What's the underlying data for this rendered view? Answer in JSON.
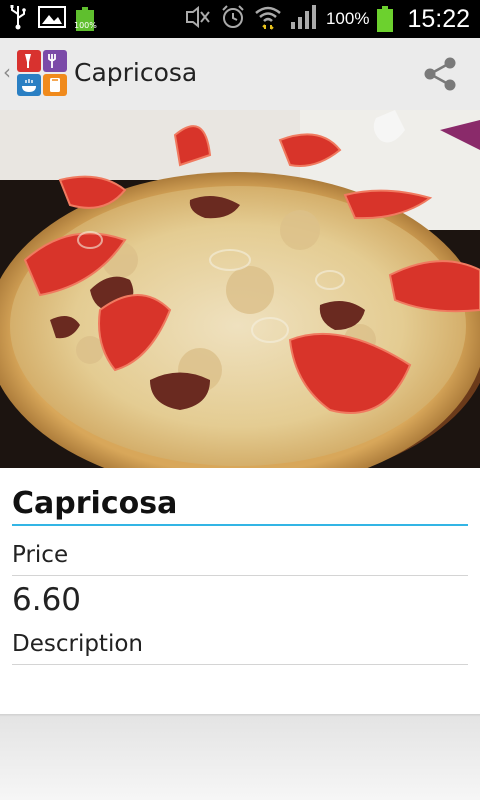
{
  "status_bar": {
    "battery_small_label": "100%",
    "battery_percent": "100%",
    "time": "15:22",
    "icons": [
      "usb-icon",
      "image-icon",
      "battery-full-icon",
      "mute-icon",
      "alarm-icon",
      "wifi-icon",
      "signal-icon",
      "battery-icon"
    ]
  },
  "action_bar": {
    "title": "Capricosa",
    "logo_icon": "restaurant-menu-icon",
    "share_icon": "share-icon",
    "colors": {
      "red": "#d8322f",
      "purple": "#7b4aa8",
      "blue": "#2a7fc3",
      "orange": "#f08a1c"
    }
  },
  "hero_image": {
    "subject": "pizza-photo"
  },
  "item": {
    "name": "Capricosa",
    "price_label": "Price",
    "price_value": "6.60",
    "description_label": "Description",
    "description_value": ""
  },
  "theme": {
    "accent": "#33b5e5"
  }
}
